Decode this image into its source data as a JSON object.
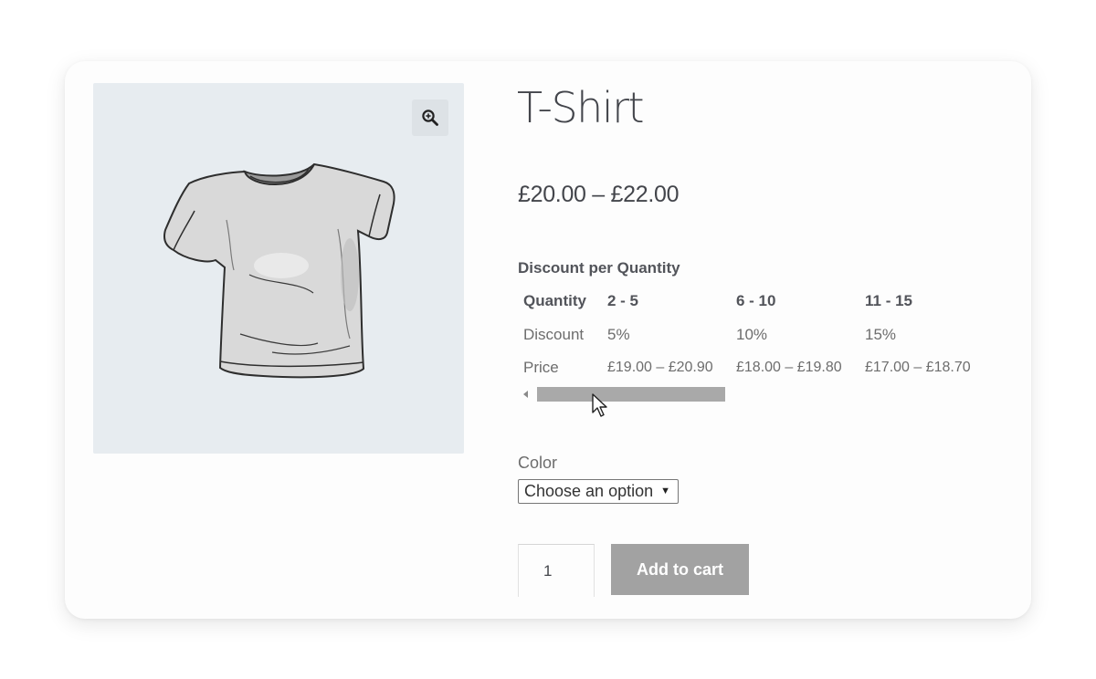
{
  "product": {
    "title": "T-Shirt",
    "price_range": "£20.00 – £22.00"
  },
  "gallery": {
    "zoom_icon": "magnifier-zoom-icon",
    "image_icon": "tshirt-image"
  },
  "discount": {
    "heading": "Discount per Quantity",
    "rows": [
      [
        "Quantity",
        "2 - 5",
        "6 - 10",
        "11 - 15"
      ],
      [
        "Discount",
        "5%",
        "10%",
        "15%"
      ],
      [
        "Price",
        "£19.00 – £20.90",
        "£18.00 – £19.80",
        "£17.00 – £18.70"
      ]
    ]
  },
  "variation": {
    "label": "Color",
    "selected": "Choose an option"
  },
  "cart": {
    "quantity": "1",
    "add_label": "Add to cart"
  },
  "colors": {
    "gallery_bg": "#e7ecf0",
    "button_bg": "#a2a2a2",
    "text": "#43454b"
  }
}
